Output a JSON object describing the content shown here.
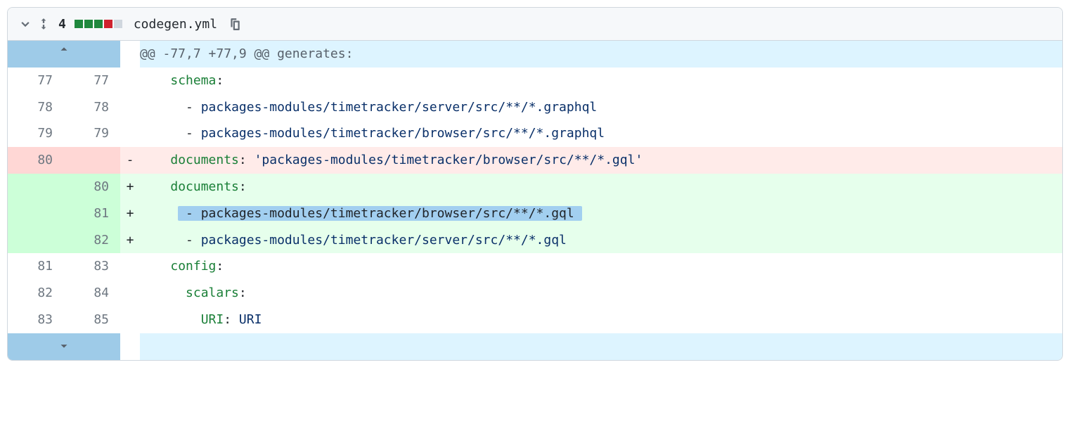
{
  "file": {
    "name": "codegen.yml",
    "change_count": "4",
    "diffstat": [
      "add",
      "add",
      "add",
      "del",
      "neutral"
    ]
  },
  "hunk_header": "@@ -77,7 +77,9 @@ generates:",
  "rows": [
    {
      "type": "ctx",
      "old": "77",
      "new": "77",
      "marker": "",
      "indent": "    ",
      "key": "schema",
      "sep": ":",
      "val": ""
    },
    {
      "type": "ctx",
      "old": "78",
      "new": "78",
      "marker": "",
      "indent": "      ",
      "key": "",
      "sep": "- ",
      "val": "packages-modules/timetracker/server/src/**/*.graphql"
    },
    {
      "type": "ctx",
      "old": "79",
      "new": "79",
      "marker": "",
      "indent": "      ",
      "key": "",
      "sep": "- ",
      "val": "packages-modules/timetracker/browser/src/**/*.graphql"
    },
    {
      "type": "del",
      "old": "80",
      "new": "",
      "marker": "-",
      "indent": "    ",
      "key": "documents",
      "sep": ": ",
      "val": "'packages-modules/timetracker/browser/src/**/*.gql'"
    },
    {
      "type": "add",
      "old": "",
      "new": "80",
      "marker": "+",
      "indent": "    ",
      "key": "documents",
      "sep": ":",
      "val": ""
    },
    {
      "type": "add",
      "old": "",
      "new": "81",
      "marker": "+",
      "indent": "      ",
      "key": "",
      "sep": "- ",
      "val": "packages-modules/timetracker/browser/src/**/*.gql",
      "highlight": true
    },
    {
      "type": "add",
      "old": "",
      "new": "82",
      "marker": "+",
      "indent": "      ",
      "key": "",
      "sep": "- ",
      "val": "packages-modules/timetracker/server/src/**/*.gql"
    },
    {
      "type": "ctx",
      "old": "81",
      "new": "83",
      "marker": "",
      "indent": "    ",
      "key": "config",
      "sep": ":",
      "val": ""
    },
    {
      "type": "ctx",
      "old": "82",
      "new": "84",
      "marker": "",
      "indent": "      ",
      "key": "scalars",
      "sep": ":",
      "val": ""
    },
    {
      "type": "ctx",
      "old": "83",
      "new": "85",
      "marker": "",
      "indent": "        ",
      "key": "URI",
      "sep": ": ",
      "val": "URI"
    }
  ]
}
